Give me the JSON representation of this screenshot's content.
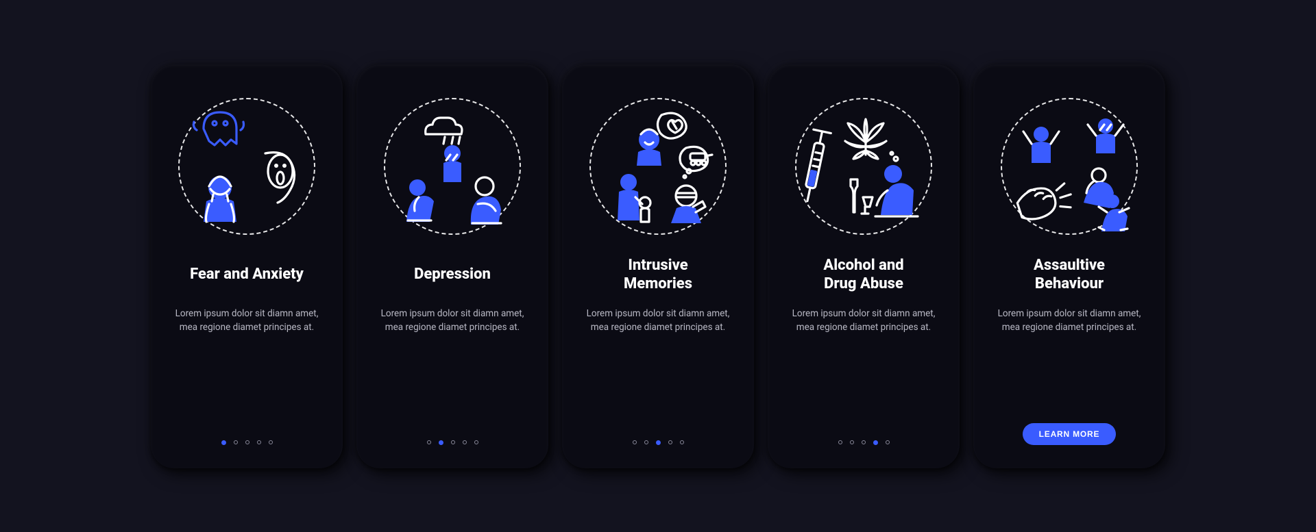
{
  "button_label": "LEARN MORE",
  "total": 5,
  "cards": [
    {
      "title": "Fear and Anxiety",
      "desc": "Lorem ipsum dolor sit diamn amet, mea regione diamet principes at.",
      "active": 0,
      "has_button": false,
      "icon": "fear-anxiety-icon"
    },
    {
      "title": "Depression",
      "desc": "Lorem ipsum dolor sit diamn amet, mea regione diamet principes at.",
      "active": 1,
      "has_button": false,
      "icon": "depression-icon"
    },
    {
      "title": "Intrusive\nMemories",
      "desc": "Lorem ipsum dolor sit diamn amet, mea regione diamet principes at.",
      "active": 2,
      "has_button": false,
      "icon": "intrusive-memories-icon"
    },
    {
      "title": "Alcohol and\nDrug Abuse",
      "desc": "Lorem ipsum dolor sit diamn amet, mea regione diamet principes at.",
      "active": 3,
      "has_button": false,
      "icon": "drug-abuse-icon"
    },
    {
      "title": "Assaultive\nBehaviour",
      "desc": "Lorem ipsum dolor sit diamn amet, mea regione diamet principes at.",
      "active": 4,
      "has_button": true,
      "icon": "assaultive-behaviour-icon"
    }
  ]
}
